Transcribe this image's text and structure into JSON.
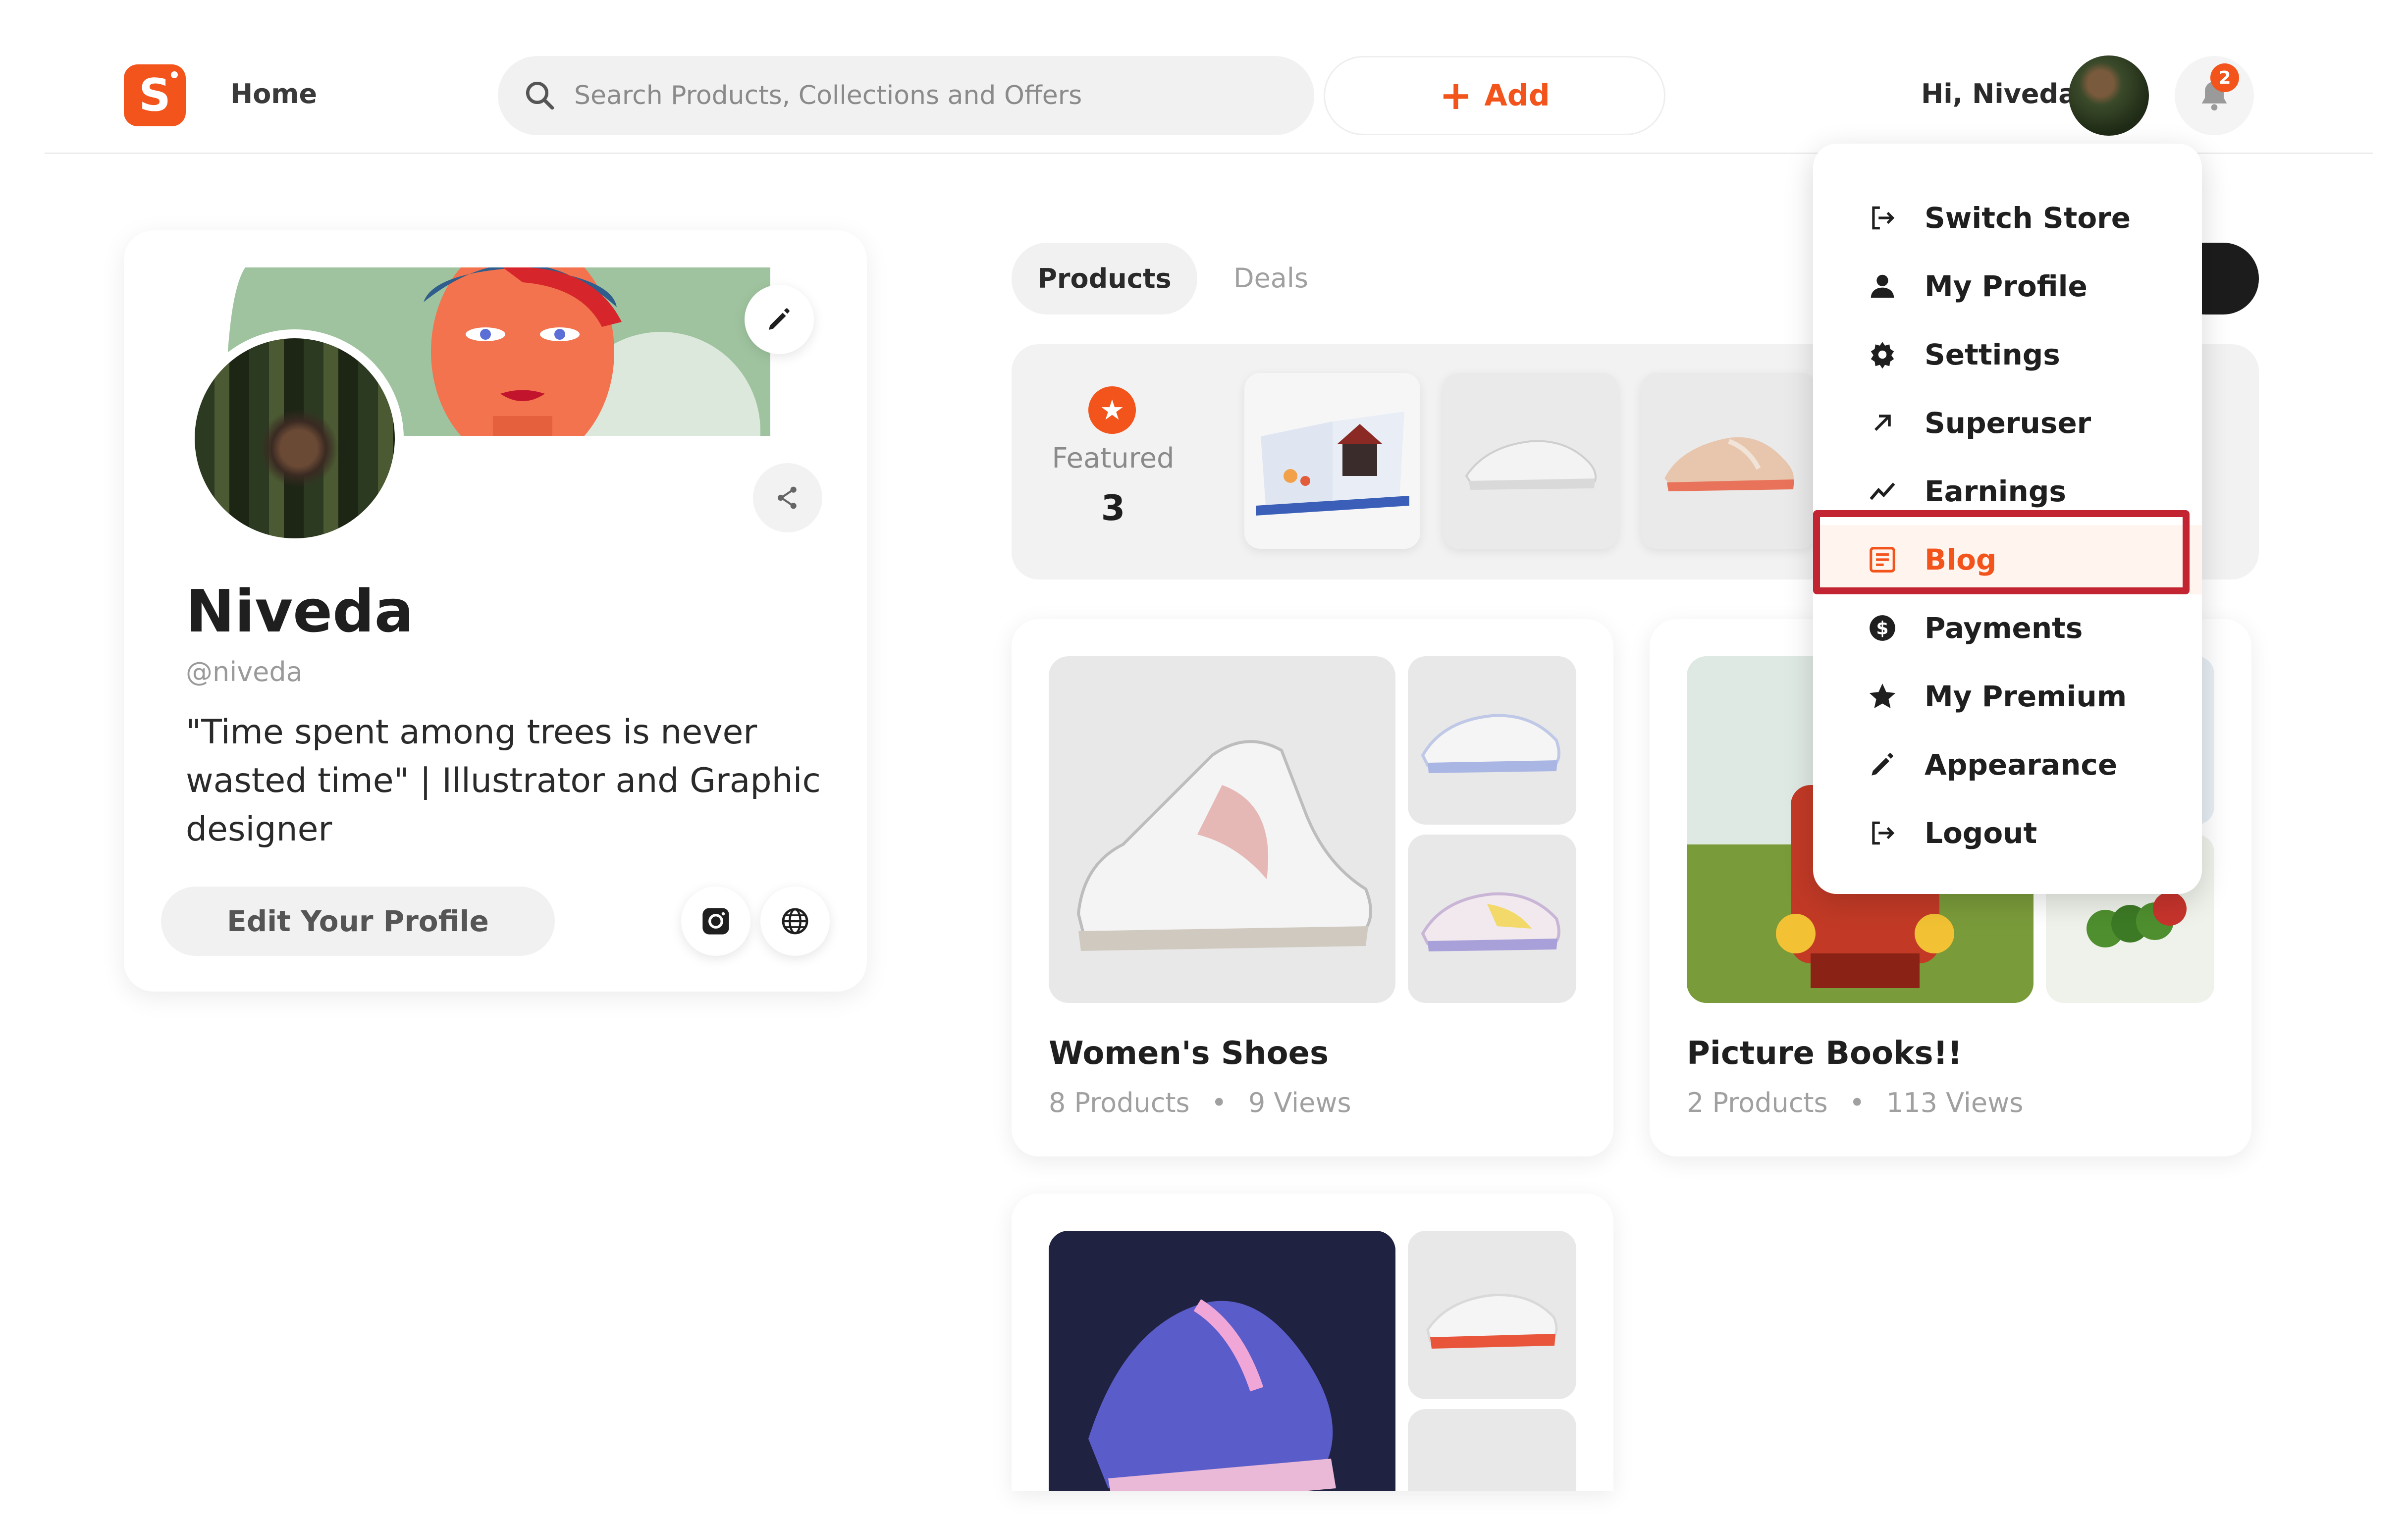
{
  "header": {
    "logo_letter": "S",
    "home_label": "Home",
    "search_placeholder": "Search Products, Collections and Offers",
    "add_label": "Add",
    "add_plus": "+",
    "greeting": "Hi, Niveda",
    "notification_count": "2"
  },
  "profile": {
    "name": "Niveda",
    "handle": "@niveda",
    "bio": "\"Time spent among trees is never wasted time\" | Illustrator and Graphic designer",
    "edit_label": "Edit Your Profile"
  },
  "tabs": {
    "products": "Products",
    "deals": "Deals"
  },
  "featured": {
    "label": "Featured",
    "count": "3"
  },
  "collections": [
    {
      "title": "Women's Shoes",
      "products": "8 Products",
      "views": "9 Views"
    },
    {
      "title": "Picture Books!!",
      "products": "2 Products",
      "views": "113 Views"
    }
  ],
  "meta_separator": "•",
  "menu": {
    "items": [
      {
        "label": "Switch Store",
        "icon": "switch-icon"
      },
      {
        "label": "My Profile",
        "icon": "user-icon"
      },
      {
        "label": "Settings",
        "icon": "gear-icon"
      },
      {
        "label": "Superuser",
        "icon": "arrow-up-right-icon"
      },
      {
        "label": "Earnings",
        "icon": "trend-icon"
      },
      {
        "label": "Blog",
        "icon": "blog-icon"
      },
      {
        "label": "Payments",
        "icon": "dollar-icon"
      },
      {
        "label": "My Premium",
        "icon": "star-icon"
      },
      {
        "label": "Appearance",
        "icon": "pencil-icon"
      },
      {
        "label": "Logout",
        "icon": "logout-icon"
      }
    ],
    "active_item": "Blog"
  },
  "colors": {
    "accent": "#f2541b",
    "highlight_border": "#c22531",
    "card_bg": "#ffffff",
    "muted_bg": "#f1f1f1"
  }
}
